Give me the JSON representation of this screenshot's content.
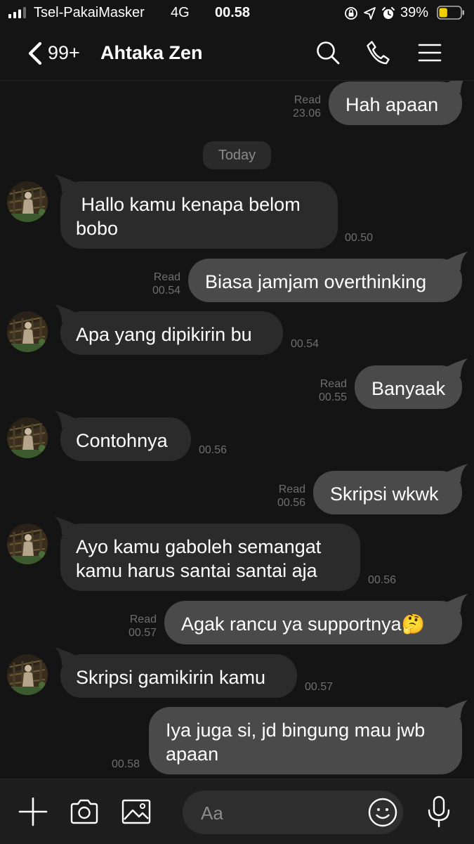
{
  "status_bar": {
    "carrier": "Tsel-PakaiMasker",
    "network": "4G",
    "time": "00.58",
    "battery_percent": "39%",
    "battery_level": 0.39,
    "battery_color": "#f5d000",
    "icons": [
      "signal-icon",
      "orientation-lock-icon",
      "location-icon",
      "alarm-icon",
      "battery-icon"
    ]
  },
  "header": {
    "back_icon": "chevron-left-icon",
    "unread_count": "99+",
    "title": "Ahtaka Zen",
    "actions": [
      "search-icon",
      "phone-icon",
      "menu-icon"
    ]
  },
  "chat": {
    "top_message": {
      "text": "Hah apaan",
      "status": "Read",
      "time": "23.06"
    },
    "day_separator": "Today",
    "messages": [
      {
        "dir": "in",
        "text": " Hallo kamu kenapa belom\nbobo",
        "time": "00.50"
      },
      {
        "dir": "out",
        "text": "Biasa jamjam overthinking",
        "status": "Read",
        "time": "00.54"
      },
      {
        "dir": "in",
        "text": "Apa yang dipikirin bu",
        "time": "00.54"
      },
      {
        "dir": "out",
        "text": "Banyaak",
        "status": "Read",
        "time": "00.55"
      },
      {
        "dir": "in",
        "text": "Contohnya",
        "time": "00.56"
      },
      {
        "dir": "out",
        "text": "Skripsi wkwk",
        "status": "Read",
        "time": "00.56"
      },
      {
        "dir": "in",
        "text": "Ayo kamu gaboleh semangat\nkamu harus santai santai aja",
        "time": "00.56"
      },
      {
        "dir": "out",
        "text": "Agak rancu ya supportnya🤔",
        "status": "Read",
        "time": "00.57"
      },
      {
        "dir": "in",
        "text": "Skripsi gamikirin kamu",
        "time": "00.57"
      },
      {
        "dir": "out",
        "text": "Iya juga si, jd bingung mau jwb\napaan",
        "status": "",
        "time": "00.58"
      }
    ]
  },
  "input_bar": {
    "placeholder": "Aa",
    "icons": [
      "plus-icon",
      "camera-icon",
      "image-icon",
      "emoji-icon",
      "microphone-icon"
    ]
  },
  "colors": {
    "background": "#141414",
    "incoming_bubble": "#2b2b2b",
    "outgoing_bubble": "#4a4a4a",
    "meta_text": "#6e6e6e"
  }
}
